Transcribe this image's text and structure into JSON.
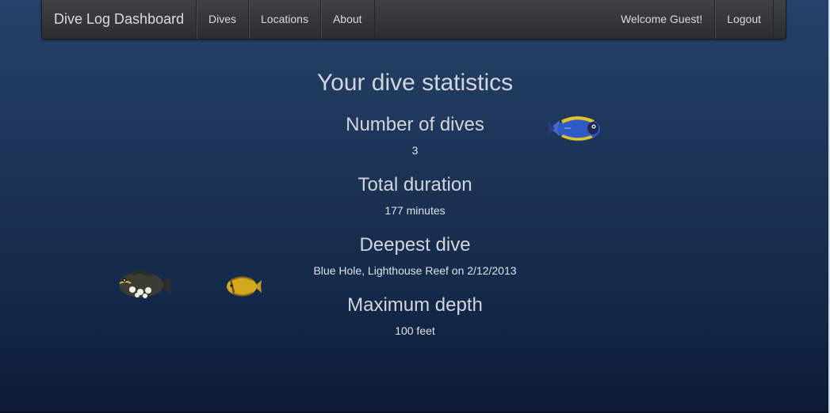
{
  "navbar": {
    "brand": "Dive Log Dashboard",
    "links": [
      "Dives",
      "Locations",
      "About"
    ],
    "welcome": "Welcome Guest!",
    "logout": "Logout"
  },
  "stats": {
    "title": "Your dive statistics",
    "number_label": "Number of dives",
    "number_value": "3",
    "duration_label": "Total duration",
    "duration_value": "177 minutes",
    "deepest_label": "Deepest dive",
    "deepest_value": "Blue Hole, Lighthouse Reef on 2/12/2013",
    "depth_label": "Maximum depth",
    "depth_value": "100 feet"
  },
  "decor": {
    "fish": [
      "blue-tang-fish",
      "triggerfish",
      "butterflyfish"
    ],
    "colors": {
      "background_top": "#26426a",
      "background_bottom": "#0c1a36",
      "navbar": "#2b2d2f"
    }
  }
}
